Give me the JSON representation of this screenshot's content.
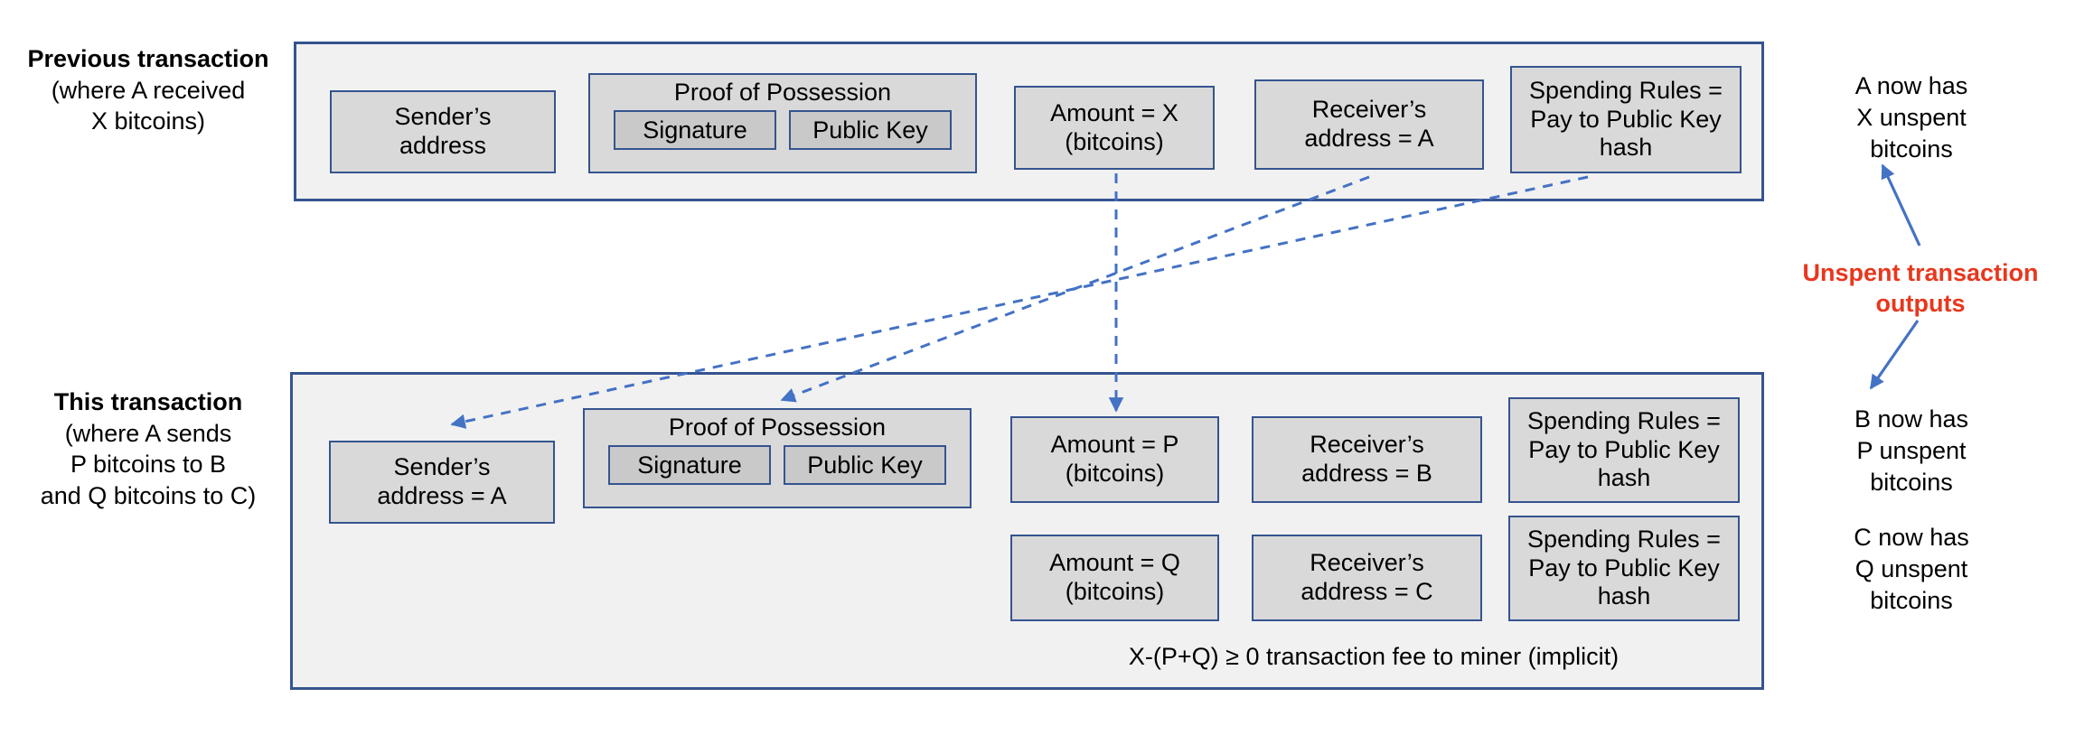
{
  "colors": {
    "box_border": "#35548f",
    "outer_fill": "#f1f1f1",
    "field_fill": "#d9d9d9",
    "chip_fill": "#c9c9c9",
    "arrow": "#4472c4",
    "highlight_red": "#e8371d"
  },
  "previous_transaction": {
    "label_title": "Previous transaction",
    "label_line2": "(where A received",
    "label_line3": "X bitcoins)",
    "sender_address": {
      "line1": "Sender’s",
      "line2": "address"
    },
    "proof_of_possession": {
      "title": "Proof of Possession",
      "signature": "Signature",
      "public_key": "Public Key"
    },
    "outputs": [
      {
        "amount_line1": "Amount = X",
        "amount_line2": "(bitcoins)",
        "receiver_line1": "Receiver’s",
        "receiver_line2": "address = A",
        "rules_line1": "Spending Rules =",
        "rules_line2": "Pay to Public Key",
        "rules_line3": "hash"
      }
    ]
  },
  "this_transaction": {
    "label_title": "This  transaction",
    "label_line2": "(where A sends",
    "label_line3": "P bitcoins to B",
    "label_line4": "and Q bitcoins to C)",
    "sender_address": {
      "line1": "Sender’s",
      "line2": "address = A"
    },
    "proof_of_possession": {
      "title": "Proof of Possession",
      "signature": "Signature",
      "public_key": "Public Key"
    },
    "outputs": [
      {
        "amount_line1": "Amount = P",
        "amount_line2": "(bitcoins)",
        "receiver_line1": "Receiver’s",
        "receiver_line2": "address = B",
        "rules_line1": "Spending Rules =",
        "rules_line2": "Pay to Public Key",
        "rules_line3": "hash"
      },
      {
        "amount_line1": "Amount = Q",
        "amount_line2": "(bitcoins)",
        "receiver_line1": "Receiver’s",
        "receiver_line2": "address = C",
        "rules_line1": "Spending Rules =",
        "rules_line2": "Pay to Public Key",
        "rules_line3": "hash"
      }
    ],
    "fee_note": "X-(P+Q) ≥ 0 transaction fee to miner (implicit)"
  },
  "annotations": {
    "a_note_line1": "A now has",
    "a_note_line2": "X unspent",
    "a_note_line3": "bitcoins",
    "utxo_line1": "Unspent transaction",
    "utxo_line2": "outputs",
    "b_note_line1": "B now has",
    "b_note_line2": "P unspent",
    "b_note_line3": "bitcoins",
    "c_note_line1": "C now has",
    "c_note_line2": "Q unspent",
    "c_note_line3": "bitcoins"
  }
}
